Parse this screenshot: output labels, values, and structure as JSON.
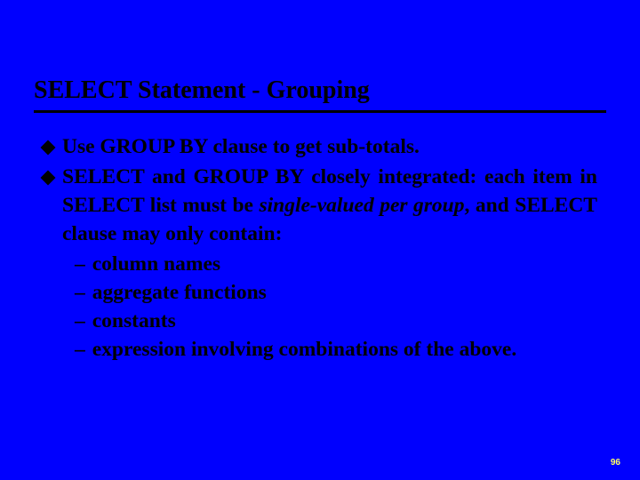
{
  "title": "SELECT Statement - Grouping",
  "bullets": {
    "b1": "Use GROUP BY clause to get sub-totals.",
    "b2_pre": "SELECT and GROUP BY closely integrated: each item in SELECT list must be ",
    "b2_em": "single-valued per group",
    "b2_post": ", and SELECT clause may only contain:"
  },
  "subs": {
    "s1": "column names",
    "s2": "aggregate functions",
    "s3": "constants",
    "s4": "expression involving combinations of the above."
  },
  "dash": "–",
  "page": "96"
}
